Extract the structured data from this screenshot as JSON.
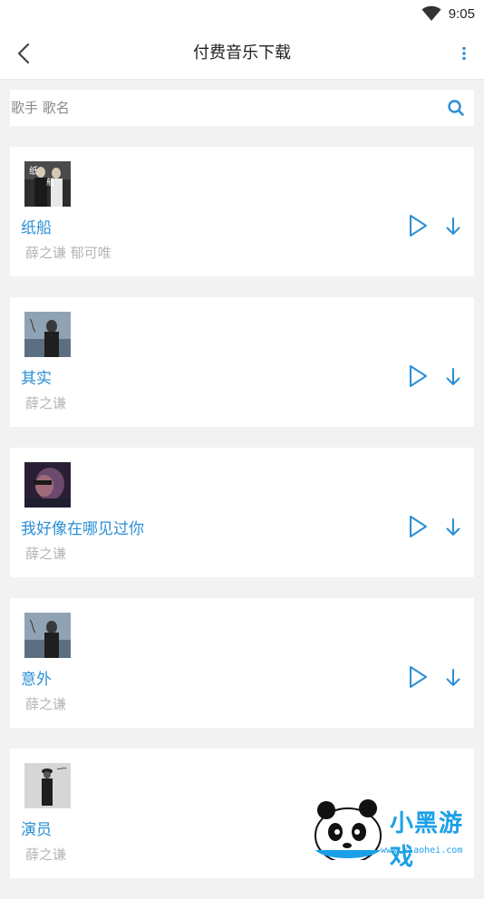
{
  "status": {
    "time": "9:05"
  },
  "header": {
    "title": "付费音乐下载"
  },
  "search": {
    "placeholder": "歌手 歌名"
  },
  "songs": [
    {
      "title": "纸船",
      "artist": "薛之谦 郁可唯",
      "cover_color": "#333333"
    },
    {
      "title": "其实",
      "artist": "薛之谦",
      "cover_color": "#7f94a8"
    },
    {
      "title": "我好像在哪见过你",
      "artist": "薛之谦",
      "cover_color": "#3a2a4a"
    },
    {
      "title": "意外",
      "artist": "薛之谦",
      "cover_color": "#7f94a8"
    },
    {
      "title": "演员",
      "artist": "薛之谦",
      "cover_color": "#cfcfcf"
    }
  ],
  "watermark": {
    "brand": "小黑游戏",
    "url": "www.xiaohei.com"
  },
  "colors": {
    "accent": "#2b8fd6",
    "muted_text": "#b5b5b5",
    "background": "#f2f2f2"
  }
}
